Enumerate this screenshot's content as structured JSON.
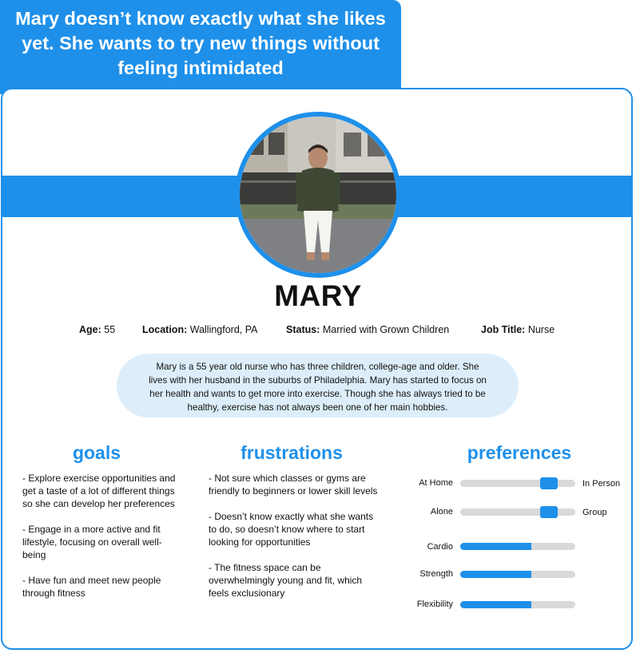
{
  "quote": "Mary doesn’t know exactly what she likes yet. She wants to try new things without feeling intimidated",
  "persona": {
    "name": "MARY",
    "age_label": "Age:",
    "age": "55",
    "location_label": "Location:",
    "location": "Wallingford, PA",
    "status_label": "Status:",
    "status": "Married with Grown Children",
    "job_label": "Job Title:",
    "job": "Nurse",
    "bio": "Mary is a 55 year old nurse who has three children, college-age and older. She lives with her husband in the suburbs of Philadelphia. Mary has started to focus on her health and wants to get more into exercise. Though she has always tried to be healthy, exercise has not always been one of her main hobbies."
  },
  "goals": {
    "title": "goals",
    "items": [
      "- Explore exercise opportunities and get a taste of a lot of different things so she can develop her preferences",
      "- Engage in a more active and fit lifestyle, focusing on overall well-being",
      "- Have fun and meet new people through fitness"
    ]
  },
  "frustrations": {
    "title": "frustrations",
    "items": [
      "- Not sure which classes or gyms are friendly to beginners or lower skill levels",
      "- Doesn’t know exactly what she wants to do, so doesn’t know where to start looking for opportunities",
      "- The fitness space can be overwhelmingly young and fit, which feels exclusionary"
    ]
  },
  "preferences": {
    "title": "preferences",
    "sliders": [
      {
        "left": "At Home",
        "right": "In Person",
        "value": 0.77
      },
      {
        "left": "Alone",
        "right": "Group",
        "value": 0.77
      }
    ],
    "bars": [
      {
        "label": "Cardio",
        "value": 0.62
      },
      {
        "label": "Strength",
        "value": 0.62
      },
      {
        "label": "Flexibility",
        "value": 0.62
      }
    ]
  },
  "colors": {
    "accent": "#1e90ea",
    "bio_bg": "#ddeefa",
    "track": "#d9d9d9"
  }
}
